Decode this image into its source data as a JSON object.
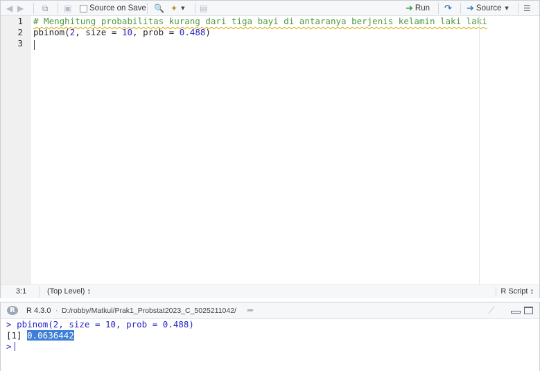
{
  "toolbar": {
    "back_icon": "arrow-left-icon",
    "forward_icon": "arrow-right-icon",
    "show_in_window_icon": "popout-icon",
    "save_icon": "floppy-disk-icon",
    "source_on_save_label": "Source on Save",
    "search_icon": "magnifier-icon",
    "code_tools_icon": "magic-wand-icon",
    "compile_report_icon": "notebook-icon",
    "run_label": "Run",
    "rerun_icon": "rerun-arrow-icon",
    "source_label": "Source",
    "outline_icon": "outline-list-icon"
  },
  "editor": {
    "line_numbers": [
      "1",
      "2",
      "3"
    ],
    "lines": {
      "comment": "# Menghitung probabilitas kurang dari tiga bayi di antaranya berjenis kelamin laki laki",
      "call_fn": "pbinom(",
      "call_arg1": "2",
      "call_mid1": ", size = ",
      "call_arg2": "10",
      "call_mid2": ", prob = ",
      "call_arg3": "0.488",
      "call_end": ")"
    }
  },
  "status": {
    "position": "3:1",
    "scope": "(Top Level) ↕",
    "file_type": "R Script ↕"
  },
  "console": {
    "r_logo": "R",
    "r_version": "R 4.3.0",
    "separator": "·",
    "working_dir": "D:/robby/Matkul/Prak1_Probstat2023_C_5025211042/",
    "prompt": ">",
    "echo_command": "pbinom(2, size = 10, prob = 0.488)",
    "output_index": "[1]",
    "output_value": "0.0636442"
  }
}
